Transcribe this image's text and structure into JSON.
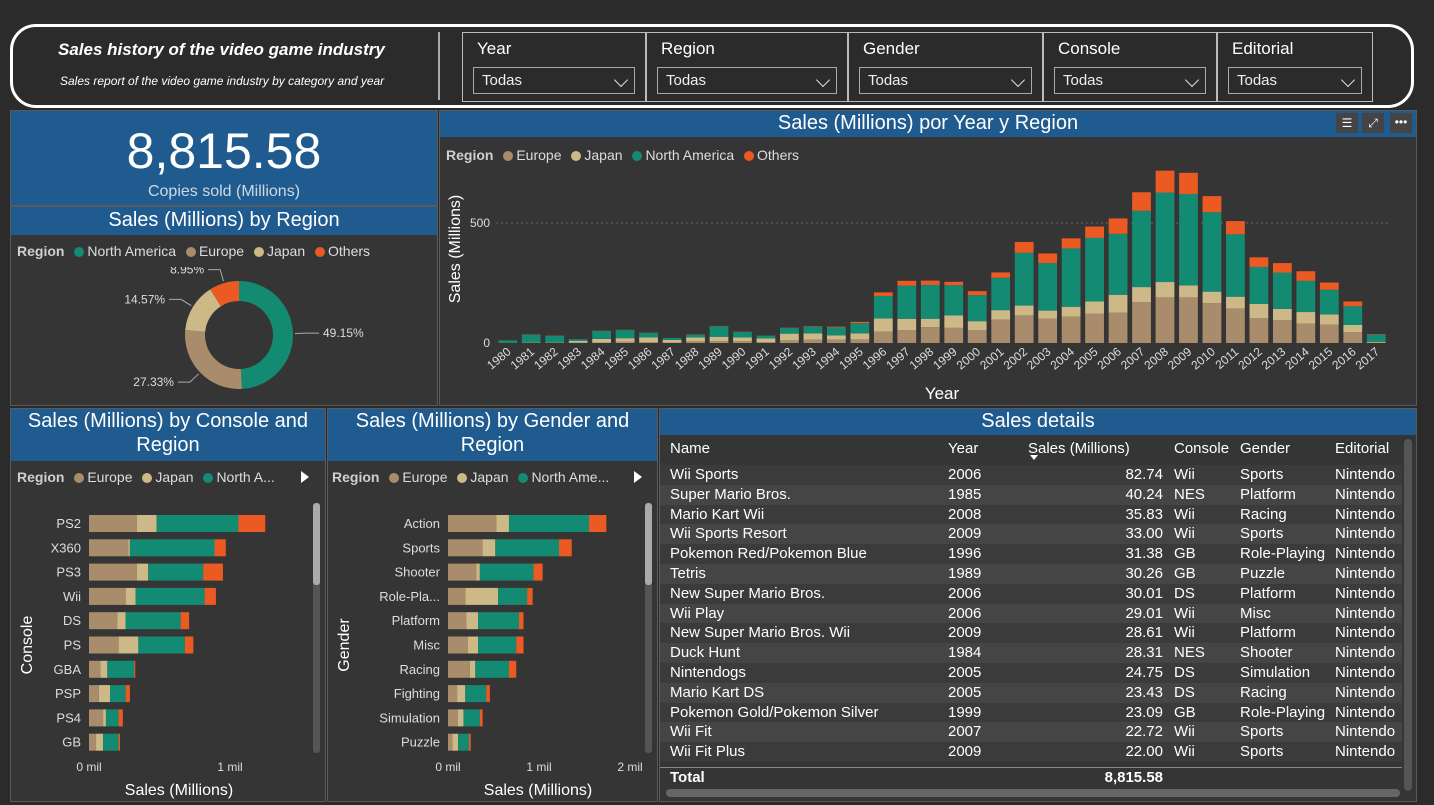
{
  "header": {
    "title": "Sales history of the video game industry",
    "subtitle": "Sales report of the video game industry by category and year"
  },
  "filters": [
    {
      "label": "Year",
      "value": "Todas"
    },
    {
      "label": "Region",
      "value": "Todas"
    },
    {
      "label": "Gender",
      "value": "Todas"
    },
    {
      "label": "Console",
      "value": "Todas"
    },
    {
      "label": "Editorial",
      "value": "Todas"
    }
  ],
  "kpi": {
    "value": "8,815.58",
    "label": "Copies sold (Millions)"
  },
  "colors": {
    "europe": "#a98c6c",
    "japan": "#cdb887",
    "north_america": "#138a72",
    "others": "#ec5a24",
    "panel_title_bg": "#1f5b8f"
  },
  "region_donut": {
    "title": "Sales (Millions) by Region",
    "legend_title": "Region",
    "legend": [
      "North America",
      "Europe",
      "Japan",
      "Others"
    ]
  },
  "year_chart": {
    "title": "Sales (Millions) por Year y Region",
    "legend_title": "Region",
    "legend": [
      "Europe",
      "Japan",
      "North America",
      "Others"
    ]
  },
  "console_chart": {
    "title": "Sales (Millions) by Console and Region",
    "legend_title": "Region",
    "legend": [
      "Europe",
      "Japan",
      "North A..."
    ]
  },
  "gender_chart": {
    "title": "Sales (Millions) by Gender and Region",
    "legend_title": "Region",
    "legend": [
      "Europe",
      "Japan",
      "North Ame..."
    ]
  },
  "chart_data": [
    {
      "type": "pie",
      "title": "Sales (Millions) by Region",
      "categories": [
        "North America",
        "Europe",
        "Japan",
        "Others"
      ],
      "values": [
        49.15,
        27.33,
        14.57,
        8.95
      ],
      "labels": [
        "49.15%",
        "27.33%",
        "14.57%",
        "8.95%"
      ],
      "legend_position": "top"
    },
    {
      "type": "bar",
      "stacked": true,
      "title": "Sales (Millions) por Year y Region",
      "xlabel": "Year",
      "ylabel": "Sales (Millions)",
      "ylim": [
        0,
        700
      ],
      "yticks": [
        0,
        500
      ],
      "categories": [
        "1980",
        "1981",
        "1982",
        "1983",
        "1984",
        "1985",
        "1986",
        "1987",
        "1988",
        "1989",
        "1990",
        "1991",
        "1992",
        "1993",
        "1994",
        "1995",
        "1996",
        "1997",
        "1998",
        "1999",
        "2000",
        "2001",
        "2002",
        "2003",
        "2004",
        "2005",
        "2006",
        "2007",
        "2008",
        "2009",
        "2010",
        "2011",
        "2012",
        "2013",
        "2014",
        "2015",
        "2016",
        "2017"
      ],
      "series": [
        {
          "name": "Europe",
          "values": [
            1,
            2,
            2,
            1,
            2,
            5,
            3,
            1,
            7,
            8,
            8,
            3,
            11,
            14,
            14,
            15,
            47,
            53,
            66,
            63,
            53,
            97,
            115,
            101,
            110,
            123,
            127,
            170,
            190,
            190,
            166,
            144,
            103,
            95,
            81,
            76,
            45,
            1
          ]
        },
        {
          "name": "Japan",
          "values": [
            0,
            0,
            0,
            8,
            15,
            15,
            20,
            12,
            16,
            18,
            15,
            16,
            28,
            26,
            18,
            25,
            55,
            48,
            35,
            52,
            38,
            40,
            41,
            34,
            41,
            50,
            74,
            63,
            64,
            50,
            48,
            49,
            60,
            47,
            48,
            43,
            30,
            4
          ]
        },
        {
          "name": "North America",
          "values": [
            10,
            33,
            28,
            7,
            33,
            34,
            19,
            8,
            12,
            44,
            23,
            12,
            24,
            28,
            33,
            43,
            94,
            138,
            141,
            126,
            108,
            135,
            220,
            198,
            243,
            265,
            254,
            318,
            373,
            381,
            331,
            260,
            154,
            151,
            130,
            103,
            78,
            30
          ]
        },
        {
          "name": "Others",
          "values": [
            0,
            1,
            1,
            0,
            1,
            1,
            1,
            0,
            1,
            1,
            1,
            0,
            1,
            2,
            3,
            5,
            15,
            20,
            18,
            14,
            17,
            22,
            45,
            40,
            42,
            47,
            64,
            77,
            91,
            88,
            67,
            55,
            40,
            40,
            40,
            30,
            20,
            2
          ]
        }
      ]
    },
    {
      "type": "bar",
      "orientation": "horizontal",
      "stacked": true,
      "title": "Sales (Millions) by Console and Region",
      "xlabel": "Sales (Millions)",
      "ylabel": "Console",
      "xticks": [
        "0 mil",
        "1 mil"
      ],
      "categories": [
        "PS2",
        "X360",
        "PS3",
        "Wii",
        "DS",
        "PS",
        "GBA",
        "PSP",
        "PS4",
        "GB"
      ],
      "series": [
        {
          "name": "Europe",
          "values": [
            340,
            280,
            340,
            260,
            200,
            210,
            80,
            70,
            100,
            50
          ]
        },
        {
          "name": "Japan",
          "values": [
            140,
            10,
            80,
            70,
            60,
            140,
            50,
            80,
            20,
            50
          ]
        },
        {
          "name": "North America",
          "values": [
            580,
            600,
            390,
            490,
            390,
            330,
            190,
            110,
            90,
            110
          ]
        },
        {
          "name": "Others",
          "values": [
            190,
            80,
            140,
            80,
            60,
            60,
            8,
            30,
            30,
            10
          ]
        }
      ]
    },
    {
      "type": "bar",
      "orientation": "horizontal",
      "stacked": true,
      "title": "Sales (Millions) by Gender and Region",
      "xlabel": "Sales (Millions)",
      "ylabel": "Gender",
      "xticks": [
        "0 mil",
        "1 mil",
        "2 mil"
      ],
      "categories": [
        "Action",
        "Sports",
        "Shooter",
        "Role-Pla...",
        "Platform",
        "Misc",
        "Racing",
        "Fighting",
        "Simulation",
        "Puzzle"
      ],
      "series": [
        {
          "name": "Europe",
          "values": [
            530,
            380,
            310,
            190,
            200,
            220,
            240,
            100,
            110,
            50
          ]
        },
        {
          "name": "Japan",
          "values": [
            140,
            140,
            40,
            360,
            130,
            110,
            60,
            90,
            60,
            60
          ]
        },
        {
          "name": "North America",
          "values": [
            880,
            700,
            590,
            320,
            450,
            420,
            370,
            230,
            180,
            120
          ]
        },
        {
          "name": "Others",
          "values": [
            190,
            140,
            100,
            60,
            50,
            80,
            80,
            40,
            30,
            20
          ]
        }
      ]
    }
  ],
  "table": {
    "title": "Sales details",
    "columns": [
      "Name",
      "Year",
      "Sales (Millions)",
      "Console",
      "Gender",
      "Editorial"
    ],
    "rows": [
      [
        "Wii Sports",
        "2006",
        "82.74",
        "Wii",
        "Sports",
        "Nintendo"
      ],
      [
        "Super Mario Bros.",
        "1985",
        "40.24",
        "NES",
        "Platform",
        "Nintendo"
      ],
      [
        "Mario Kart Wii",
        "2008",
        "35.83",
        "Wii",
        "Racing",
        "Nintendo"
      ],
      [
        "Wii Sports Resort",
        "2009",
        "33.00",
        "Wii",
        "Sports",
        "Nintendo"
      ],
      [
        "Pokemon Red/Pokemon Blue",
        "1996",
        "31.38",
        "GB",
        "Role-Playing",
        "Nintendo"
      ],
      [
        "Tetris",
        "1989",
        "30.26",
        "GB",
        "Puzzle",
        "Nintendo"
      ],
      [
        "New Super Mario Bros.",
        "2006",
        "30.01",
        "DS",
        "Platform",
        "Nintendo"
      ],
      [
        "Wii Play",
        "2006",
        "29.01",
        "Wii",
        "Misc",
        "Nintendo"
      ],
      [
        "New Super Mario Bros. Wii",
        "2009",
        "28.61",
        "Wii",
        "Platform",
        "Nintendo"
      ],
      [
        "Duck Hunt",
        "1984",
        "28.31",
        "NES",
        "Shooter",
        "Nintendo"
      ],
      [
        "Nintendogs",
        "2005",
        "24.75",
        "DS",
        "Simulation",
        "Nintendo"
      ],
      [
        "Mario Kart DS",
        "2005",
        "23.43",
        "DS",
        "Racing",
        "Nintendo"
      ],
      [
        "Pokemon Gold/Pokemon Silver",
        "1999",
        "23.09",
        "GB",
        "Role-Playing",
        "Nintendo"
      ],
      [
        "Wii Fit",
        "2007",
        "22.72",
        "Wii",
        "Sports",
        "Nintendo"
      ],
      [
        "Wii Fit Plus",
        "2009",
        "22.00",
        "Wii",
        "Sports",
        "Nintendo"
      ]
    ],
    "total_label": "Total",
    "total_value": "8,815.58"
  }
}
